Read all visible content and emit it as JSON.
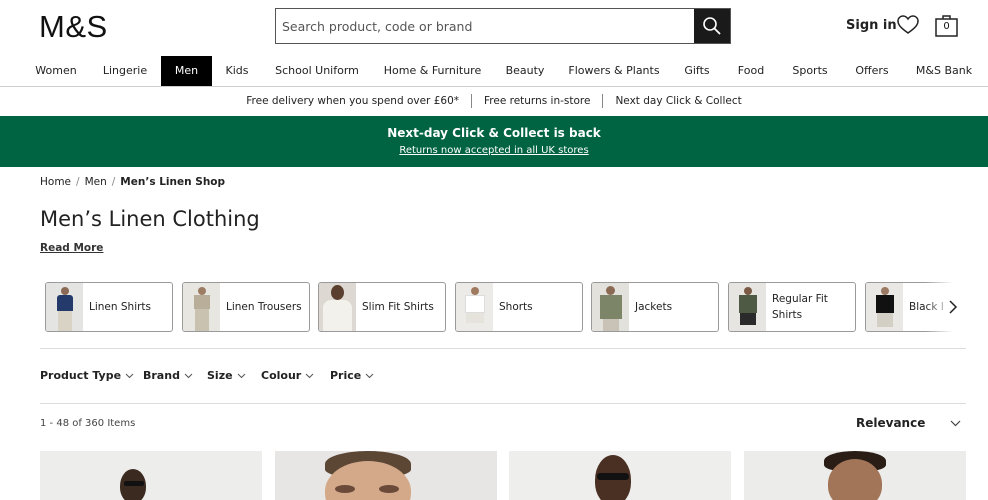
{
  "header": {
    "logo": "M&S",
    "search_placeholder": "Search product, code or brand",
    "sign_in": "Sign in",
    "bag_count": "0"
  },
  "nav": [
    "Women",
    "Lingerie",
    "Men",
    "Kids",
    "School Uniform",
    "Home & Furniture",
    "Beauty",
    "Flowers & Plants",
    "Gifts",
    "Food",
    "Sports",
    "Offers",
    "M&S Bank"
  ],
  "nav_active": "Men",
  "usp": [
    "Free delivery when you spend over £60*",
    "Free returns in-store",
    "Next day Click & Collect"
  ],
  "promo": {
    "title": "Next-day Click & Collect is back",
    "link": "Returns now accepted in all UK stores",
    "color": "#006341"
  },
  "breadcrumb": [
    "Home",
    "Men",
    "Men’s Linen Shop"
  ],
  "page": {
    "title": "Men’s Linen Clothing",
    "read_more": "Read More"
  },
  "categories": [
    "Linen Shirts",
    "Linen Trousers",
    "Slim Fit Shirts",
    "Shorts",
    "Jackets",
    "Regular Fit Shirts",
    "Black Linen"
  ],
  "filters": [
    "Product Type",
    "Brand",
    "Size",
    "Colour",
    "Price"
  ],
  "results": {
    "count": "1 - 48 of 360 Items",
    "sort": "Relevance"
  }
}
